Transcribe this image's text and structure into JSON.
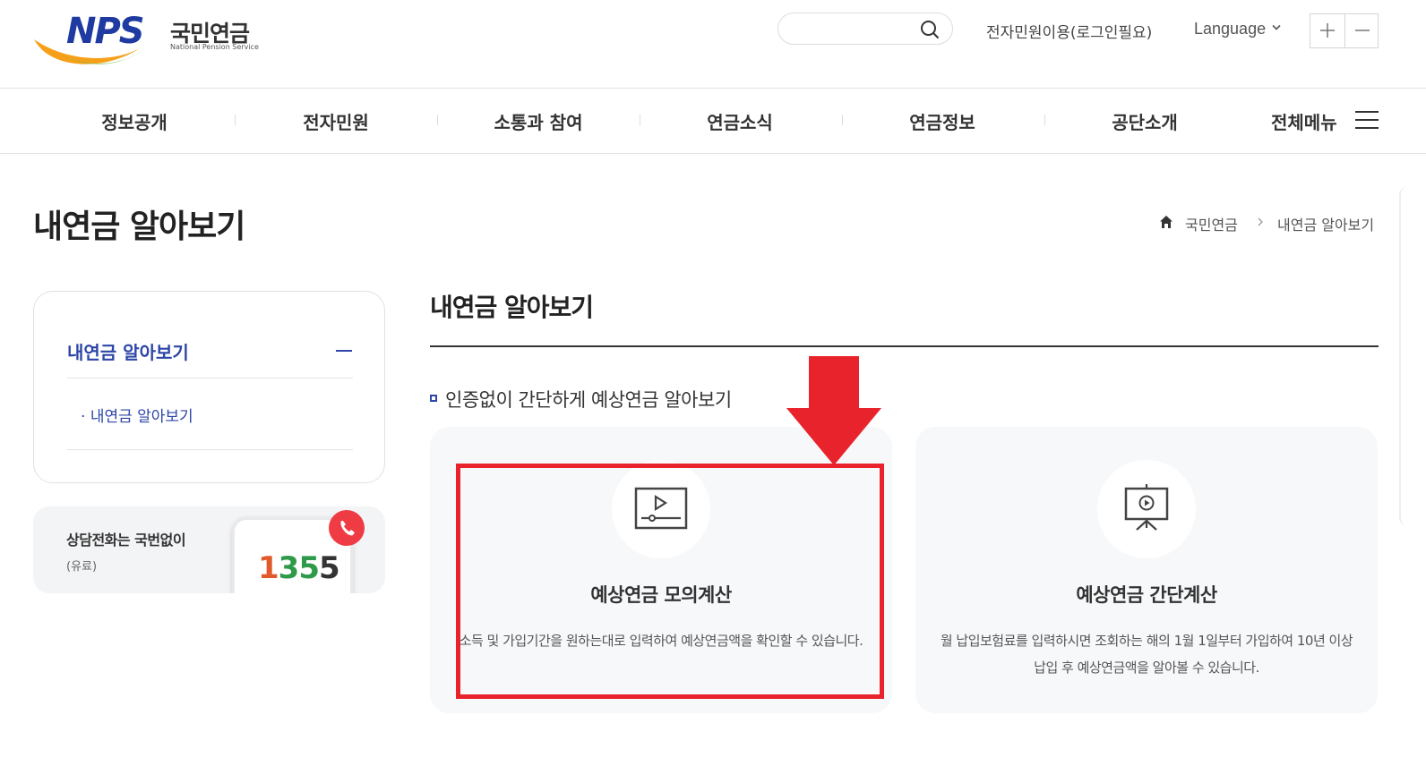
{
  "header": {
    "logo_text": "NPS",
    "logo_ko": "국민연금",
    "logo_en": "National Pension Service",
    "search_placeholder": "",
    "electronic_civil_link": "전자민원이용(로그인필요)",
    "language_label": "Language"
  },
  "gnb": {
    "items": [
      "정보공개",
      "전자민원",
      "소통과 참여",
      "연금소식",
      "연금정보",
      "공단소개"
    ],
    "all_menu": "전체메뉴"
  },
  "page": {
    "title": "내연금 알아보기",
    "breadcrumb": [
      "국민연금",
      "내연금 알아보기"
    ]
  },
  "sidebar": {
    "title": "내연금 알아보기",
    "sub_items": [
      "내연금 알아보기"
    ]
  },
  "call_banner": {
    "title": "상담전화는 국번없이",
    "sub": "(유료)",
    "number_digits": [
      "1",
      "3",
      "5",
      "5"
    ]
  },
  "main": {
    "title": "내연금 알아보기",
    "section_text": "인증없이 간단하게 예상연금 알아보기",
    "cards": [
      {
        "title": "예상연금 모의계산",
        "desc": "소득 및 가입기간을 원하는대로 입력하여 예상연금액을 확인할 수 있습니다.",
        "icon": "video-player-icon"
      },
      {
        "title": "예상연금 간단계산",
        "desc": "월 납입보험료를 입력하시면 조회하는 해의 1월 1일부터 가입하여 10년 이상 납입 후 예상연금액을 알아볼 수 있습니다.",
        "icon": "presentation-screen-icon"
      }
    ]
  },
  "colors": {
    "brand_blue": "#2d46a8",
    "highlight_red": "#e8232b",
    "card_bg": "#f7f8fa"
  }
}
